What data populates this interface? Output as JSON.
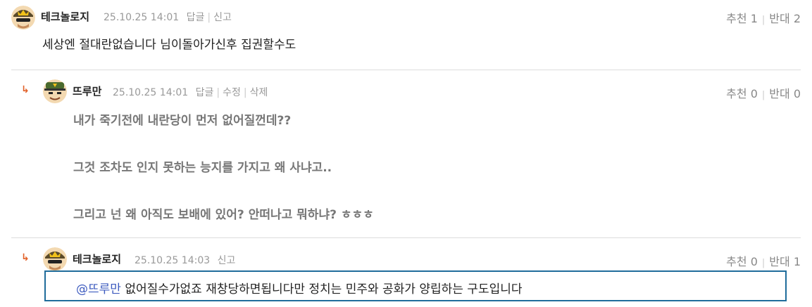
{
  "comments": [
    {
      "nickname": "테크놀로지",
      "date": "25.10.25 14:01",
      "actions": [
        "답글",
        "신고"
      ],
      "votes": {
        "up_label": "추천",
        "up": "1",
        "down_label": "반대",
        "down": "2"
      },
      "text": "세상엔 절대란없습니다 님이돌아가신후 집권할수도"
    },
    {
      "nickname": "뜨루만",
      "date": "25.10.25 14:01",
      "actions": [
        "답글",
        "수정",
        "삭제"
      ],
      "votes": {
        "up_label": "추천",
        "up": "0",
        "down_label": "반대",
        "down": "0"
      },
      "lines": [
        "내가 죽기전에 내란당이 먼저 없어질껀데??",
        "그것 조차도 인지 못하는 능지를 가지고 왜 사냐고..",
        "그리고 넌 왜 아직도 보배에 있어? 안떠나고 뭐하냐? ㅎㅎㅎ"
      ]
    },
    {
      "nickname": "테크놀로지",
      "date": "25.10.25 14:03",
      "actions": [
        "신고"
      ],
      "votes": {
        "up_label": "추천",
        "up": "0",
        "down_label": "반대",
        "down": "1"
      },
      "mention": "@뜨루만",
      "text": "없어질수가없죠 재창당하면됩니다만 정치는 민주와 공화가 양립하는 구도입니다"
    }
  ],
  "reply_arrow": "↳",
  "colors": {
    "accent": "#1f6c9b",
    "mention": "#3d5bbf",
    "reply_arrow": "#e2622a"
  }
}
